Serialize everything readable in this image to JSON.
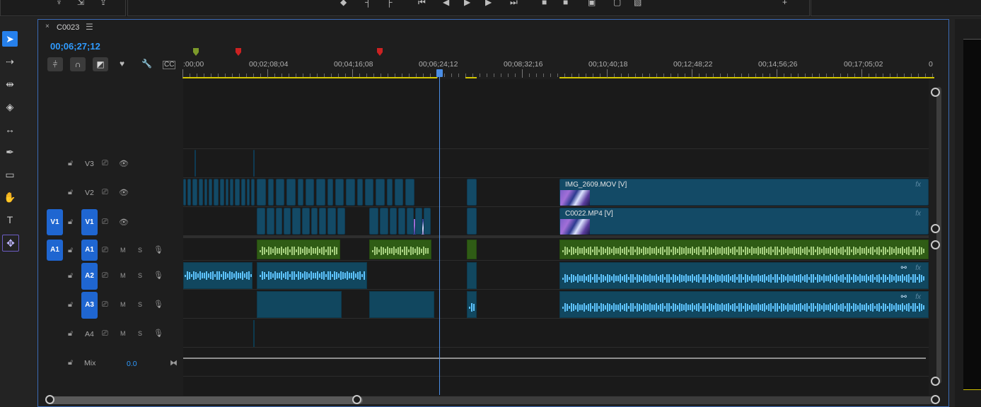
{
  "app": {
    "sequence_tab": "C0023",
    "timecode": "00;06;27;12"
  },
  "ruler": {
    "labels": [
      ":00;00",
      "00;02;08;04",
      "00;04;16;08",
      "00;06;24;12",
      "00;08;32;16",
      "00;10;40;18",
      "00;12;48;22",
      "00;14;56;26",
      "00;17;05;02",
      "0"
    ]
  },
  "tracks": {
    "video": [
      {
        "name": "V3",
        "source": ""
      },
      {
        "name": "V2",
        "source": ""
      },
      {
        "name": "V1",
        "source": "V1"
      }
    ],
    "audio": [
      {
        "name": "A1",
        "source": "A1",
        "m": "M",
        "s": "S"
      },
      {
        "name": "A2",
        "source": "",
        "m": "M",
        "s": "S"
      },
      {
        "name": "A3",
        "source": "",
        "m": "M",
        "s": "S"
      },
      {
        "name": "A4",
        "source": "",
        "m": "M",
        "s": "S"
      }
    ],
    "mix": {
      "label": "Mix",
      "value": "0.0"
    }
  },
  "clips": {
    "v2_main": {
      "label": "IMG_2609.MOV [V]",
      "fx": "fx"
    },
    "v1_main": {
      "label": "C0022.MP4 [V]",
      "fx": "fx"
    },
    "a2_fx": "fx",
    "a3_fx": "fx"
  },
  "colors": {
    "accent": "#2f9bff",
    "video_clip": "#134a66",
    "audio_green": "#2f5c15",
    "audio_blue": "#11475f",
    "track_button": "#1f66d1"
  },
  "icons": [
    "selection-tool-icon",
    "track-select-icon",
    "ripple-edit-icon",
    "razor-icon",
    "slip-icon",
    "pen-icon",
    "rectangle-icon",
    "hand-icon",
    "type-icon",
    "generate-icon"
  ]
}
